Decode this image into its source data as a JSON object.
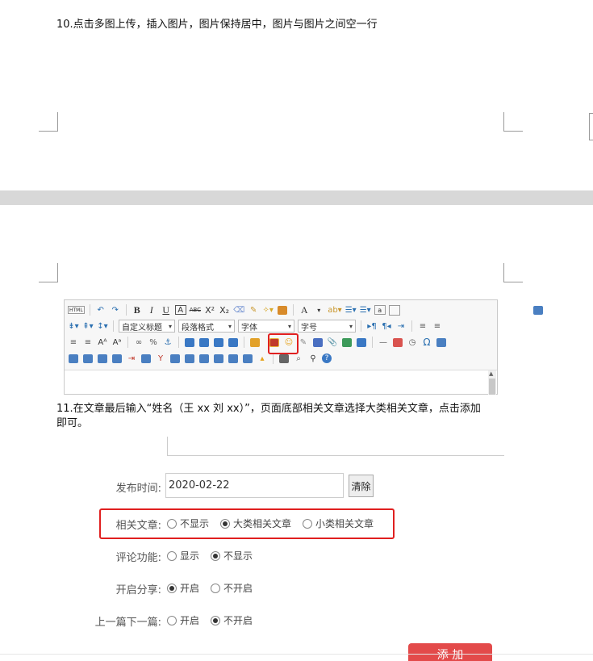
{
  "step10": {
    "text": "10.点击多图上传，插入图片，图片保持居中，图片与图片之间空一行"
  },
  "step11": {
    "text_line1": "11.在文章最后输入“姓名（王 xx 刘 xx）”，页面底部相关文章选择大类相关文章，点击添加",
    "text_line2": "即可。"
  },
  "editor": {
    "row1": {
      "html": "HTML",
      "bold": "B",
      "italic": "I",
      "underline": "U",
      "font_border": "A",
      "strike": "ABC",
      "sup": "X²",
      "sub": "X₂",
      "font_color": "A"
    },
    "row2": {
      "custom_title": "自定义标题",
      "paragraph": "段落格式",
      "font_family": "字体",
      "font_size": "字号"
    },
    "row3": {
      "omega": "Ω"
    },
    "accent_highlight": "#e02020"
  },
  "form": {
    "publish_time_label": "发布时间:",
    "publish_time_value": "2020-02-22",
    "clear_label": "清除",
    "related_label": "相关文章:",
    "related_options": [
      "不显示",
      "大类相关文章",
      "小类相关文章"
    ],
    "comment_label": "评论功能:",
    "comment_options": [
      "显示",
      "不显示"
    ],
    "share_label": "开启分享:",
    "share_options": [
      "开启",
      "不开启"
    ],
    "prevnext_label": "上一篇下一篇:",
    "prevnext_options": [
      "开启",
      "不开启"
    ],
    "add_label": "添 加",
    "add_color": "#e34a4a"
  }
}
